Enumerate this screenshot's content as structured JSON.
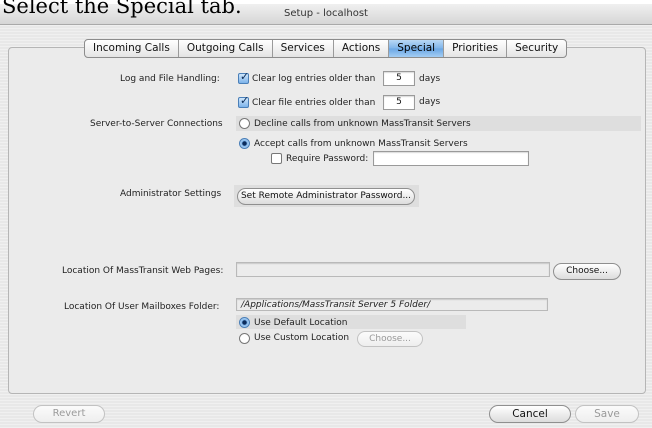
{
  "caption": "Select the Special tab.",
  "window_title": "Setup - localhost",
  "tabs": [
    {
      "label": "Incoming Calls",
      "active": false
    },
    {
      "label": "Outgoing Calls",
      "active": false
    },
    {
      "label": "Services",
      "active": false
    },
    {
      "label": "Actions",
      "active": false
    },
    {
      "label": "Special",
      "active": true
    },
    {
      "label": "Priorities",
      "active": false
    },
    {
      "label": "Security",
      "active": false
    }
  ],
  "log_file": {
    "section_label": "Log and File Handling:",
    "clear_log": {
      "checked": true,
      "label": "Clear log entries older than",
      "value": "5",
      "unit": "days"
    },
    "clear_file": {
      "checked": true,
      "label": "Clear file entries older than",
      "value": "5",
      "unit": "days"
    }
  },
  "server": {
    "section_label": "Server-to-Server Connections",
    "decline": {
      "label": "Decline calls from unknown MassTransit Servers",
      "selected": false
    },
    "accept": {
      "label": "Accept calls from unknown MassTransit Servers",
      "selected": true
    },
    "require_password": {
      "label": "Require Password:",
      "checked": false,
      "value": ""
    }
  },
  "admin": {
    "section_label": "Administrator Settings",
    "button": "Set Remote Administrator Password..."
  },
  "web_pages": {
    "label": "Location Of MassTransit Web Pages:",
    "value": "",
    "choose": "Choose..."
  },
  "mailboxes": {
    "label": "Location Of User Mailboxes Folder:",
    "path": "/Applications/MassTransit Server 5 Folder/",
    "default": {
      "label": "Use Default Location",
      "selected": true
    },
    "custom": {
      "label": "Use Custom Location",
      "selected": false
    },
    "choose": "Choose..."
  },
  "footer": {
    "revert": "Revert",
    "cancel": "Cancel",
    "save": "Save"
  }
}
